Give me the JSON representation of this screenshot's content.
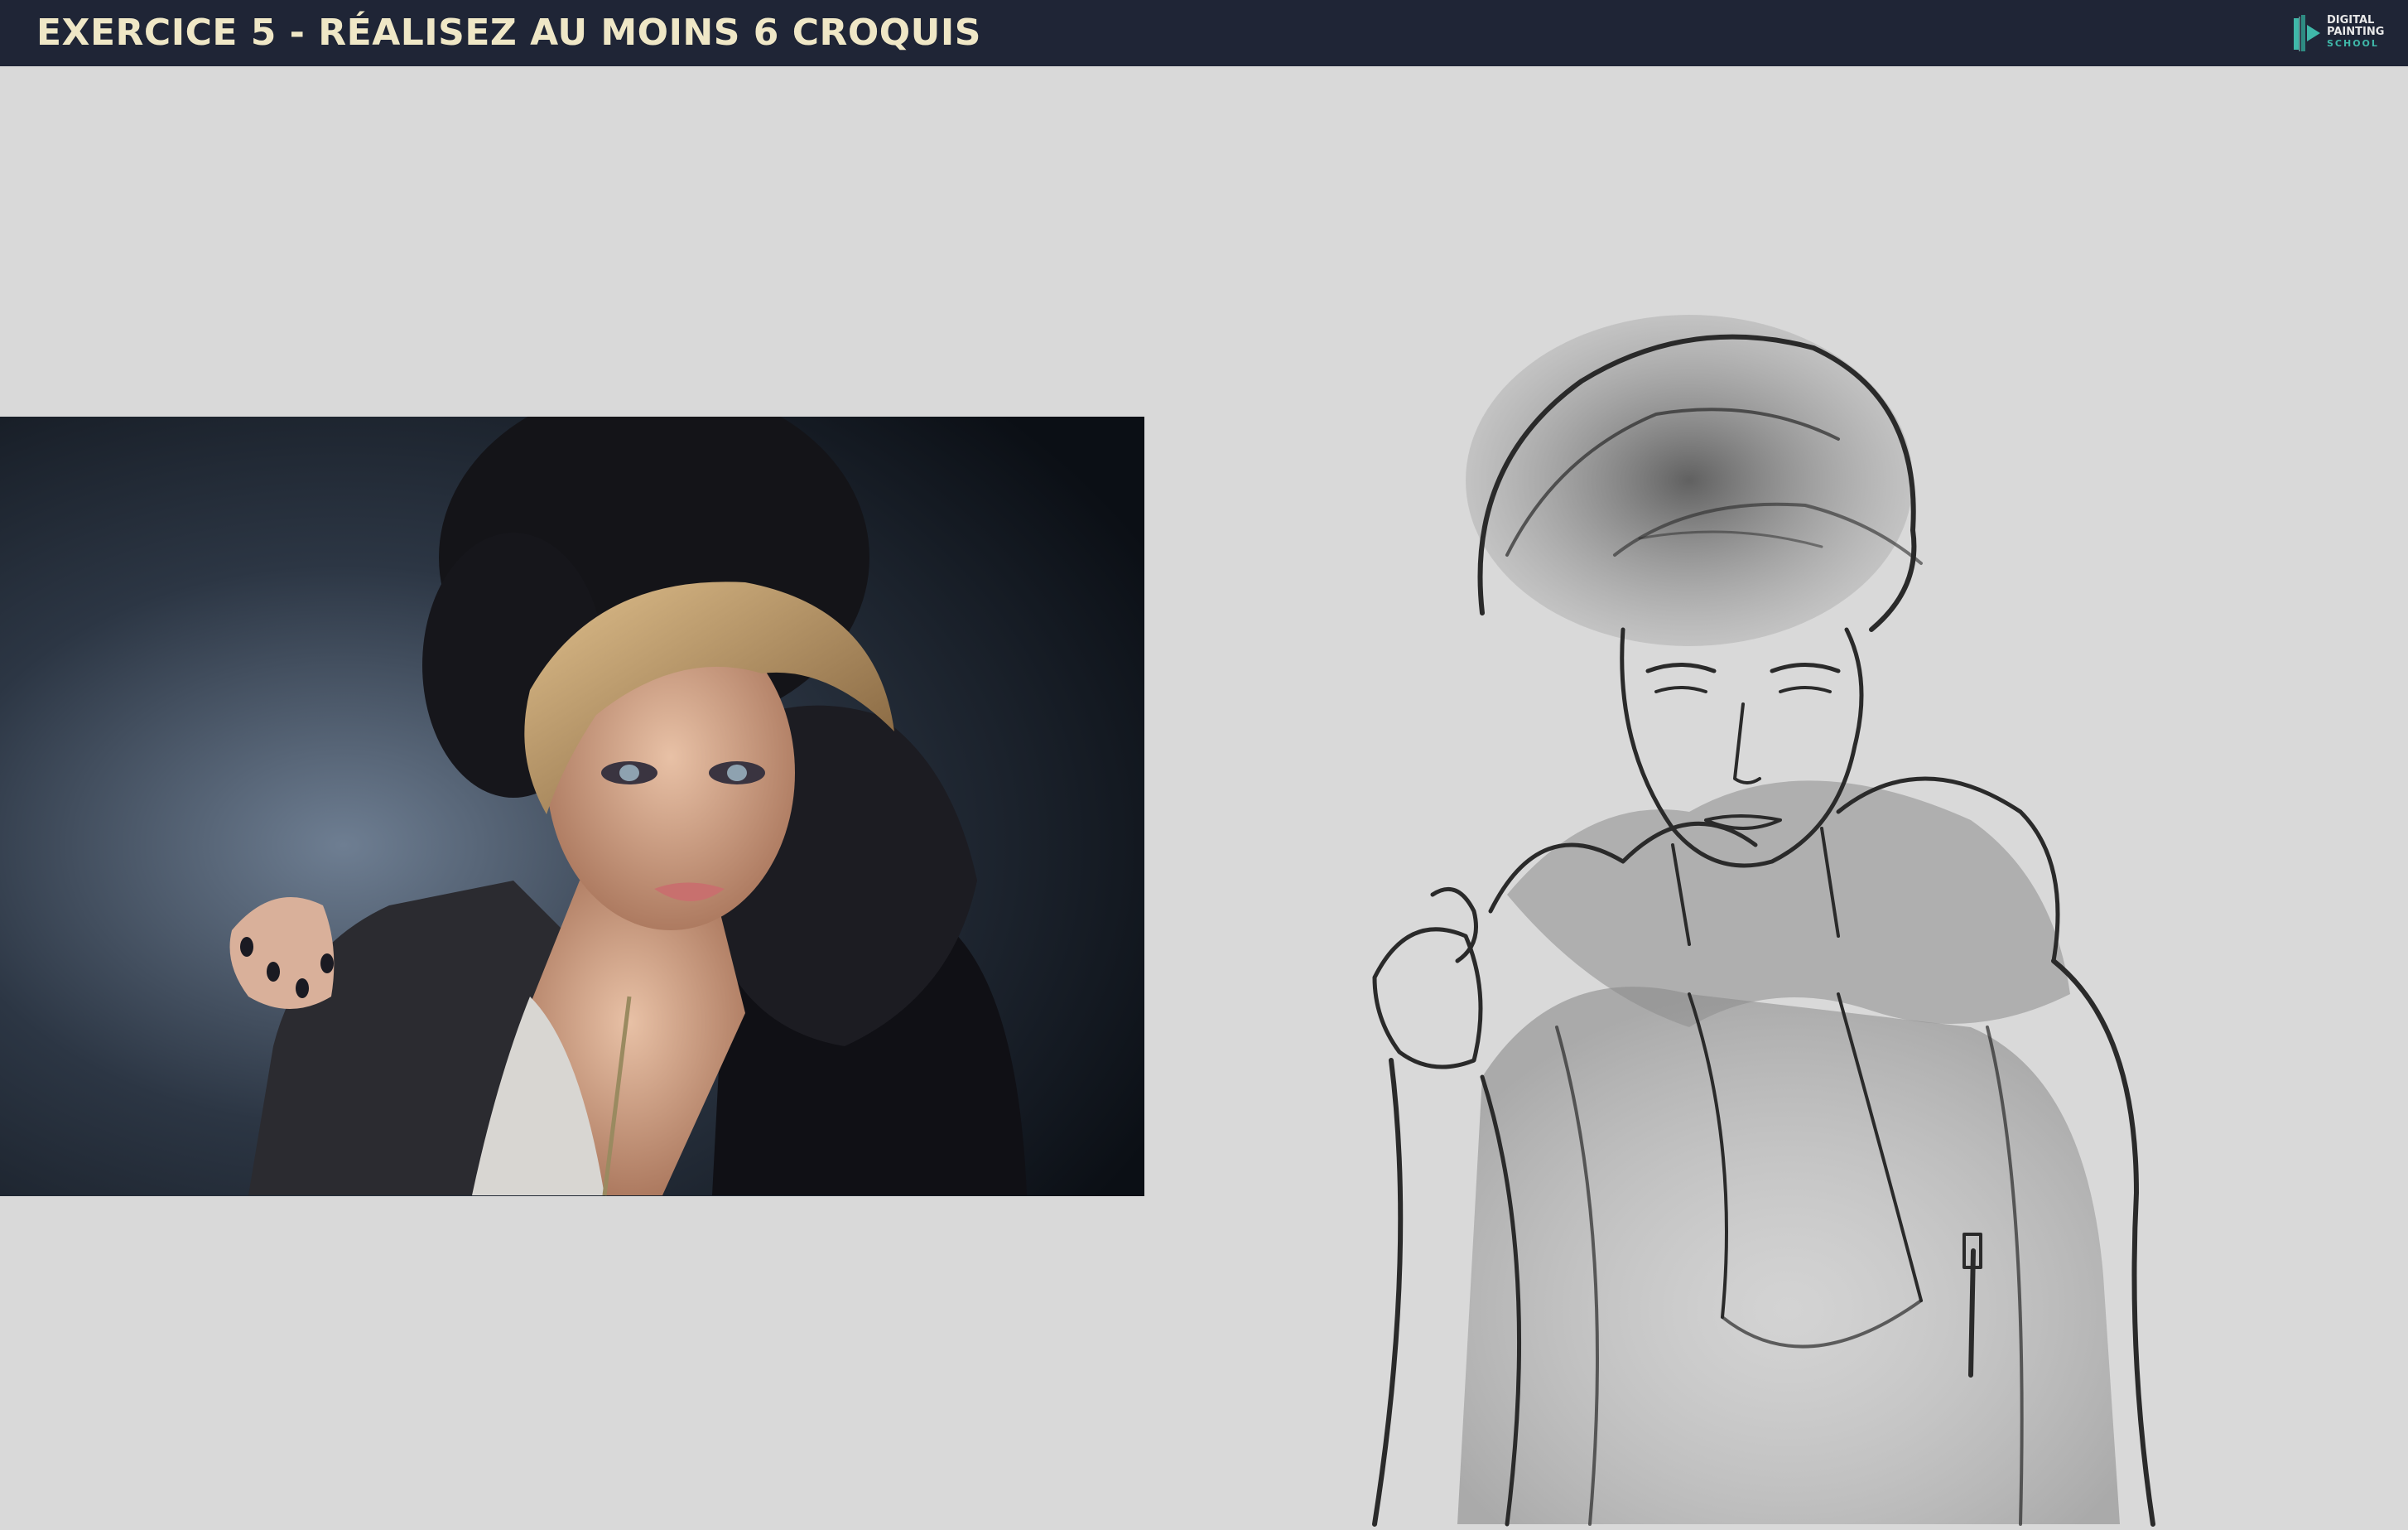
{
  "header": {
    "title": "EXERCICE 5 - RÉALISEZ AU MOINS 6 CROQUIS",
    "logo_lines": [
      "DIGITAL",
      "PAINTING",
      "SCHOOL"
    ]
  },
  "colors": {
    "header_bg": "#1f2536",
    "title_text": "#efe7c6",
    "page_bg": "#d9d9d9",
    "logo_accent": "#3fb8a9"
  },
  "icons": {
    "logo": "digital-painting-school-logo"
  }
}
